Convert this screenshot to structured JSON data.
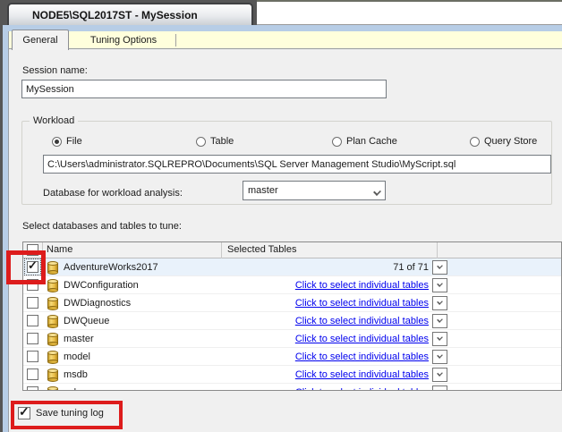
{
  "doc_tab_title": "NODE5\\SQL2017ST - MySession",
  "tabs": {
    "general": "General",
    "tuning_options": "Tuning Options"
  },
  "session": {
    "label": "Session name:",
    "value": "MySession"
  },
  "workload": {
    "legend": "Workload",
    "options": [
      {
        "label": "File",
        "selected": true
      },
      {
        "label": "Table",
        "selected": false
      },
      {
        "label": "Plan Cache",
        "selected": false
      },
      {
        "label": "Query Store",
        "selected": false
      }
    ],
    "file_path": "C:\\Users\\administrator.SQLREPRO\\Documents\\SQL Server Management Studio\\MyScript.sql",
    "analysis_label": "Database for workload analysis:",
    "analysis_value": "master"
  },
  "tune_section": {
    "label": "Select databases and tables to tune:",
    "header": {
      "name": "Name",
      "selected_tables": "Selected Tables"
    },
    "rows": [
      {
        "name": "AdventureWorks2017",
        "checked": true,
        "focused": true,
        "highlighted": true,
        "value": "71 of 71",
        "is_link": false
      },
      {
        "name": "DWConfiguration",
        "checked": false,
        "focused": false,
        "highlighted": false,
        "value": "Click to select individual tables",
        "is_link": true
      },
      {
        "name": "DWDiagnostics",
        "checked": false,
        "focused": false,
        "highlighted": false,
        "value": "Click to select individual tables",
        "is_link": true
      },
      {
        "name": "DWQueue",
        "checked": false,
        "focused": false,
        "highlighted": false,
        "value": "Click to select individual tables",
        "is_link": true
      },
      {
        "name": "master",
        "checked": false,
        "focused": false,
        "highlighted": false,
        "value": "Click to select individual tables",
        "is_link": true
      },
      {
        "name": "model",
        "checked": false,
        "focused": false,
        "highlighted": false,
        "value": "Click to select individual tables",
        "is_link": true
      },
      {
        "name": "msdb",
        "checked": false,
        "focused": false,
        "highlighted": false,
        "value": "Click to select individual tables",
        "is_link": true
      },
      {
        "name": "sqlnexus",
        "checked": false,
        "focused": false,
        "highlighted": false,
        "value": "Click to select individual tables",
        "is_link": true
      }
    ]
  },
  "footer": {
    "save_tuning_log_label": "Save tuning log",
    "checked": true
  },
  "colors": {
    "annotation_red": "#dd1c1c",
    "link_blue": "#0000ee",
    "selected_row_blue": "#e9f2fb",
    "tabstrip_yellow": "#ffffdc",
    "frame_blue": "#b7cde6",
    "content_gray": "#f0f0f0",
    "header_dark": "#565656"
  }
}
